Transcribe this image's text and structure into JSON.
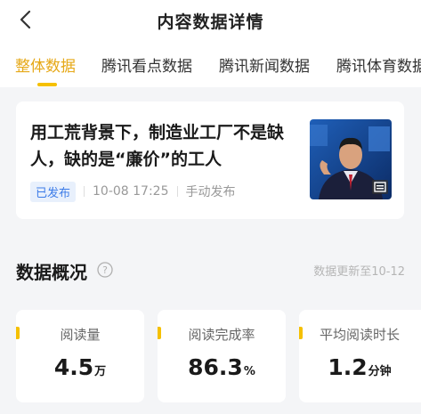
{
  "header": {
    "title": "内容数据详情",
    "back_icon": "chevron-left-icon"
  },
  "tabs": [
    {
      "label": "整体数据",
      "active": true
    },
    {
      "label": "腾讯看点数据",
      "active": false
    },
    {
      "label": "腾讯新闻数据",
      "active": false
    },
    {
      "label": "腾讯体育数据",
      "active": false
    }
  ],
  "colors": {
    "accent": "#f5c000",
    "active_tab_text": "#e6a817",
    "badge_blue": "#3b7be8"
  },
  "article": {
    "title": "用工荒背景下，制造业工厂不是缺人，缺的是“廉价”的工人",
    "status": "已发布",
    "time": "10-08 17:25",
    "publish_method": "手动发布",
    "thumbnail_icon": "gallery-icon"
  },
  "overview": {
    "title": "数据概况",
    "help_icon": "question-circle-icon",
    "update_text": "数据更新至10-12"
  },
  "stats": [
    {
      "label": "阅读量",
      "value": "4.5",
      "unit": "万"
    },
    {
      "label": "阅读完成率",
      "value": "86.3",
      "unit": "%"
    },
    {
      "label": "平均阅读时长",
      "value": "1.2",
      "unit": "分钟"
    }
  ]
}
